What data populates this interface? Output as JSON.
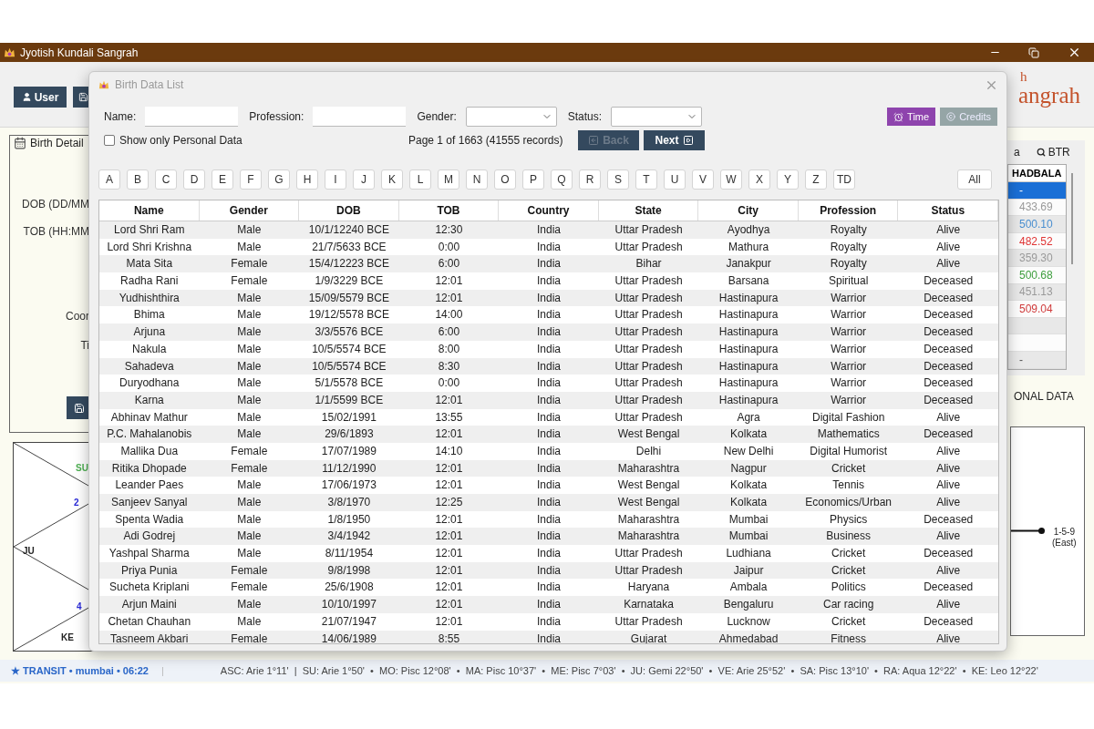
{
  "app": {
    "title": "Jyotish Kundali Sangrah",
    "user_button": "User",
    "logo_top": "h",
    "logo_main": "angrah"
  },
  "birth_details": {
    "title": "Birth Detail",
    "labels": [
      "DOB (DD/MM",
      "TOB (HH:MM",
      "Coor",
      "Ti"
    ]
  },
  "chart_left": {
    "labels": [
      {
        "text": "SU",
        "color": "#4caf50"
      },
      {
        "text": "2",
        "color": "#2a2ad8"
      },
      {
        "text": "JU",
        "color": "#222222"
      },
      {
        "text": "4",
        "color": "#2a2ad8"
      },
      {
        "text": "KE",
        "color": "#222222"
      }
    ]
  },
  "right_panel": {
    "tabs": [
      {
        "label": "a"
      },
      {
        "label": "BTR"
      }
    ],
    "shadbala_header": "HADBALA",
    "rows": [
      {
        "value": "-",
        "selected": true
      },
      {
        "value": "433.69",
        "selected": false,
        "color": "#9a9a9a"
      },
      {
        "value": "500.10",
        "selected": false,
        "color": "#4a8fd0"
      },
      {
        "value": "482.52",
        "selected": false,
        "color": "#e03535"
      },
      {
        "value": "359.30",
        "selected": false,
        "color": "#9a9a9a"
      },
      {
        "value": "500.68",
        "selected": false,
        "color": "#3f9f3f"
      },
      {
        "value": "451.13",
        "selected": false,
        "color": "#9a9a9a"
      },
      {
        "value": "509.04",
        "selected": false,
        "color": "#d03c3c"
      },
      {
        "selected": false
      },
      {
        "selected": false
      },
      {
        "value": "-",
        "selected": false
      }
    ],
    "footer": "ONAL DATA"
  },
  "chart_right": {
    "label": "1-5-9",
    "sublabel": "(East)"
  },
  "status_bar": {
    "transit": "★ TRANSIT • mumbai • 06:22",
    "separator": "|",
    "positions": "ASC: Arie 1°11'  |  SU: Arie 1°50'  •  MO: Pisc 12°08'  •  MA: Pisc 10°37'  •  ME: Pisc 7°03'  •  JU: Gemi 22°50'  •  VE: Arie 25°52'  •  SA: Pisc 13°10'  •  RA: Aqua 12°22'  •  KE: Leo 12°22'"
  },
  "dialog": {
    "title": "Birth Data List",
    "filters": [
      {
        "label": "Name:",
        "kind": "text"
      },
      {
        "label": "Profession:",
        "kind": "text"
      },
      {
        "label": "Gender:",
        "kind": "select"
      },
      {
        "label": "Status:",
        "kind": "select"
      }
    ],
    "buttons": [
      {
        "label": "Time",
        "kind": "time"
      },
      {
        "label": "Credits",
        "kind": "credits"
      }
    ],
    "personal_only": {
      "label": "Show only Personal Data",
      "checked": false
    },
    "page_info": "Page 1 of 1663 (41555 records)",
    "nav": [
      {
        "label": "Back",
        "kind": "back",
        "disabled": true
      },
      {
        "label": "Next",
        "kind": "next",
        "disabled": false
      }
    ],
    "letters": [
      "A",
      "B",
      "C",
      "D",
      "E",
      "F",
      "G",
      "H",
      "I",
      "J",
      "K",
      "L",
      "M",
      "N",
      "O",
      "P",
      "Q",
      "R",
      "S",
      "T",
      "U",
      "V",
      "W",
      "X",
      "Y",
      "Z",
      "TD"
    ],
    "all_label": "All",
    "table": {
      "columns": [
        "Name",
        "Gender",
        "DOB",
        "TOB",
        "Country",
        "State",
        "City",
        "Profession",
        "Status"
      ],
      "rows": [
        [
          "Lord Shri Ram",
          "Male",
          "10/1/12240 BCE",
          "12:30",
          "India",
          "Uttar Pradesh",
          "Ayodhya",
          "Royalty",
          "Alive"
        ],
        [
          "Lord Shri Krishna",
          "Male",
          "21/7/5633 BCE",
          "0:00",
          "India",
          "Uttar Pradesh",
          "Mathura",
          "Royalty",
          "Alive"
        ],
        [
          "Mata Sita",
          "Female",
          "15/4/12223 BCE",
          "6:00",
          "India",
          "Bihar",
          "Janakpur",
          "Royalty",
          "Alive"
        ],
        [
          "Radha Rani",
          "Female",
          "1/9/3229 BCE",
          "12:01",
          "India",
          "Uttar Pradesh",
          "Barsana",
          "Spiritual",
          "Deceased"
        ],
        [
          "Yudhishthira",
          "Male",
          "15/09/5579 BCE",
          "12:01",
          "India",
          "Uttar Pradesh",
          "Hastinapura",
          "Warrior",
          "Deceased"
        ],
        [
          "Bhima",
          "Male",
          "19/12/5578 BCE",
          "14:00",
          "India",
          "Uttar Pradesh",
          "Hastinapura",
          "Warrior",
          "Deceased"
        ],
        [
          "Arjuna",
          "Male",
          "3/3/5576 BCE",
          "6:00",
          "India",
          "Uttar Pradesh",
          "Hastinapura",
          "Warrior",
          "Deceased"
        ],
        [
          "Nakula",
          "Male",
          "10/5/5574 BCE",
          "8:00",
          "India",
          "Uttar Pradesh",
          "Hastinapura",
          "Warrior",
          "Deceased"
        ],
        [
          "Sahadeva",
          "Male",
          "10/5/5574 BCE",
          "8:30",
          "India",
          "Uttar Pradesh",
          "Hastinapura",
          "Warrior",
          "Deceased"
        ],
        [
          "Duryodhana",
          "Male",
          "5/1/5578 BCE",
          "0:00",
          "India",
          "Uttar Pradesh",
          "Hastinapura",
          "Warrior",
          "Deceased"
        ],
        [
          "Karna",
          "Male",
          "1/1/5599 BCE",
          "12:01",
          "India",
          "Uttar Pradesh",
          "Hastinapura",
          "Warrior",
          "Deceased"
        ],
        [
          "Abhinav Mathur",
          "Male",
          "15/02/1991",
          "13:55",
          "India",
          "Uttar Pradesh",
          "Agra",
          "Digital Fashion",
          "Alive"
        ],
        [
          "P.C. Mahalanobis",
          "Male",
          "29/6/1893",
          "12:01",
          "India",
          "West Bengal",
          "Kolkata",
          "Mathematics",
          "Deceased"
        ],
        [
          "Mallika Dua",
          "Female",
          "17/07/1989",
          "14:10",
          "India",
          "Delhi",
          "New Delhi",
          "Digital Humorist",
          "Alive"
        ],
        [
          "Ritika Dhopade",
          "Female",
          "11/12/1990",
          "12:01",
          "India",
          "Maharashtra",
          "Nagpur",
          "Cricket",
          "Alive"
        ],
        [
          "Leander Paes",
          "Male",
          "17/06/1973",
          "12:01",
          "India",
          "West Bengal",
          "Kolkata",
          "Tennis",
          "Alive"
        ],
        [
          "Sanjeev Sanyal",
          "Male",
          "3/8/1970",
          "12:25",
          "India",
          "West Bengal",
          "Kolkata",
          "Economics/Urban",
          "Alive"
        ],
        [
          "Spenta Wadia",
          "Male",
          "1/8/1950",
          "12:01",
          "India",
          "Maharashtra",
          "Mumbai",
          "Physics",
          "Deceased"
        ],
        [
          "Adi Godrej",
          "Male",
          "3/4/1942",
          "12:01",
          "India",
          "Maharashtra",
          "Mumbai",
          "Business",
          "Alive"
        ],
        [
          "Yashpal Sharma",
          "Male",
          "8/11/1954",
          "12:01",
          "India",
          "Uttar Pradesh",
          "Ludhiana",
          "Cricket",
          "Deceased"
        ],
        [
          "Priya Punia",
          "Female",
          "9/8/1998",
          "12:01",
          "India",
          "Uttar Pradesh",
          "Jaipur",
          "Cricket",
          "Alive"
        ],
        [
          "Sucheta Kriplani",
          "Female",
          "25/6/1908",
          "12:01",
          "India",
          "Haryana",
          "Ambala",
          "Politics",
          "Deceased"
        ],
        [
          "Arjun Maini",
          "Male",
          "10/10/1997",
          "12:01",
          "India",
          "Karnataka",
          "Bengaluru",
          "Car racing",
          "Alive"
        ],
        [
          "Chetan Chauhan",
          "Male",
          "21/07/1947",
          "12:01",
          "India",
          "Uttar Pradesh",
          "Lucknow",
          "Cricket",
          "Deceased"
        ],
        [
          "Tasneem Akbari",
          "Female",
          "14/06/1989",
          "8:55",
          "India",
          "Gujarat",
          "Ahmedabad",
          "Fitness",
          "Alive"
        ]
      ]
    }
  }
}
